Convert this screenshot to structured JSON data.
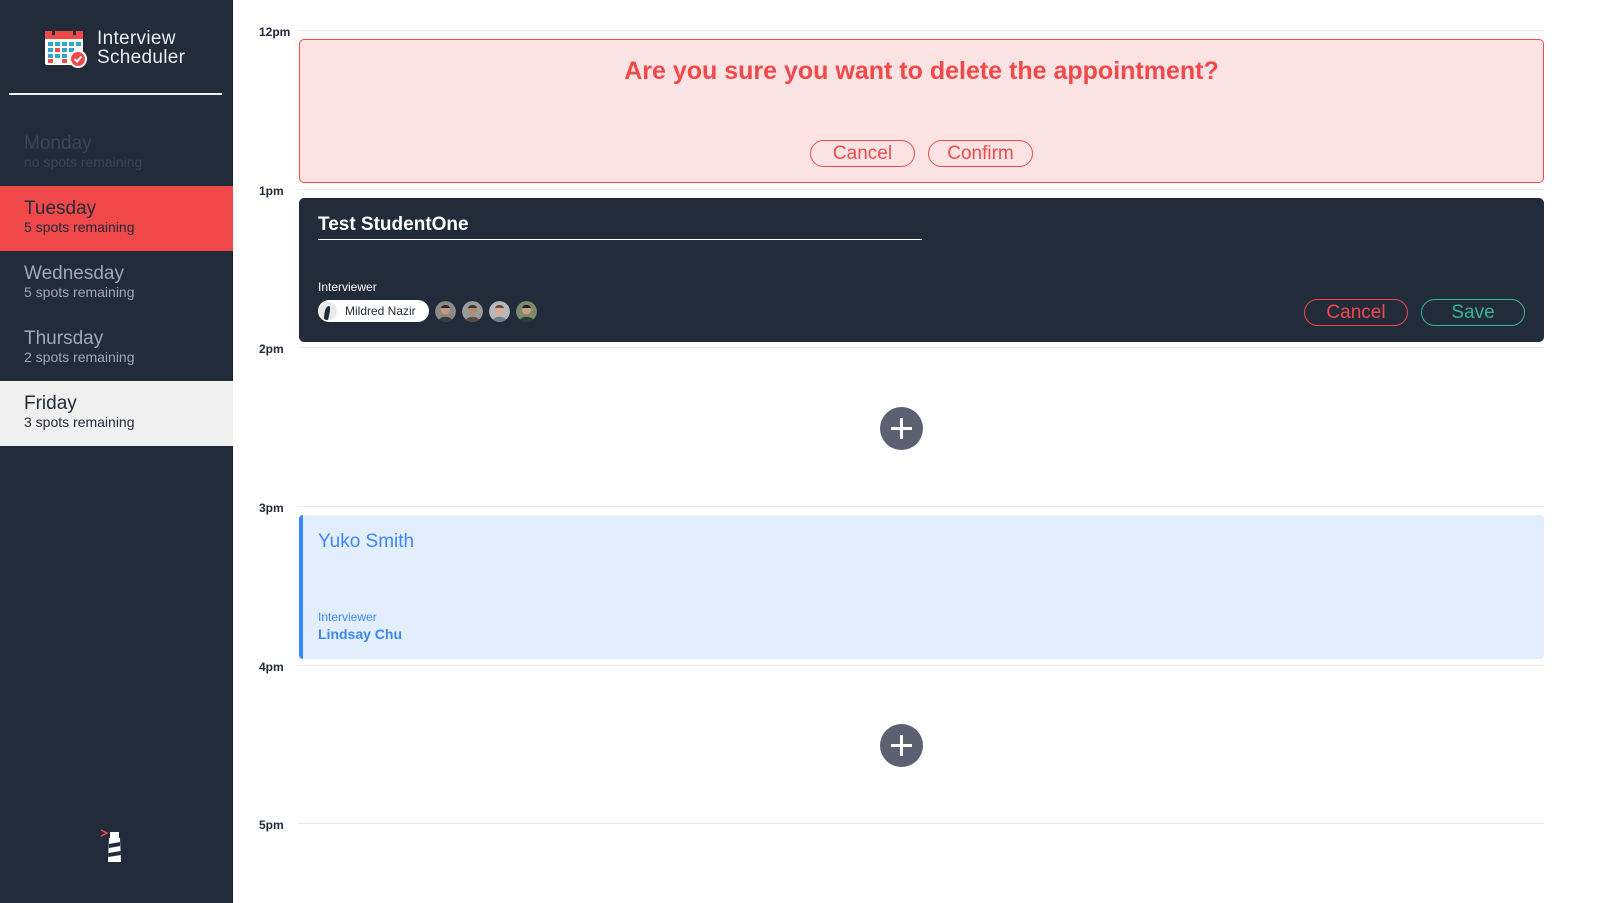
{
  "app": {
    "title_line1": "Interview",
    "title_line2": "Scheduler"
  },
  "days": [
    {
      "name": "Monday",
      "spots": "no spots remaining",
      "state": "full"
    },
    {
      "name": "Tuesday",
      "spots": "5 spots remaining",
      "state": "selected"
    },
    {
      "name": "Wednesday",
      "spots": "5 spots remaining",
      "state": "normal"
    },
    {
      "name": "Thursday",
      "spots": "2 spots remaining",
      "state": "normal"
    },
    {
      "name": "Friday",
      "spots": "3 spots remaining",
      "state": "hovered"
    }
  ],
  "times": [
    "12pm",
    "1pm",
    "2pm",
    "3pm",
    "4pm",
    "5pm"
  ],
  "confirm": {
    "message": "Are you sure you want to delete the appointment?",
    "cancel_label": "Cancel",
    "confirm_label": "Confirm"
  },
  "form": {
    "student_name": "Test StudentOne",
    "interviewer_heading": "Interviewer",
    "selected_interviewer": "Mildred Nazir",
    "cancel_label": "Cancel",
    "save_label": "Save"
  },
  "show": {
    "student": "Yuko Smith",
    "interviewer_heading": "Interviewer",
    "interviewer": "Lindsay Chu"
  },
  "colors": {
    "sidebar": "#222b39",
    "accent_red": "#f1494a",
    "save_green": "#37b594",
    "show_blue": "#3c87f7",
    "show_bg": "#e3eefd"
  },
  "icons": {
    "logo": "calendar-icon",
    "add": "plus-icon",
    "footer": "lighthouse-icon"
  }
}
